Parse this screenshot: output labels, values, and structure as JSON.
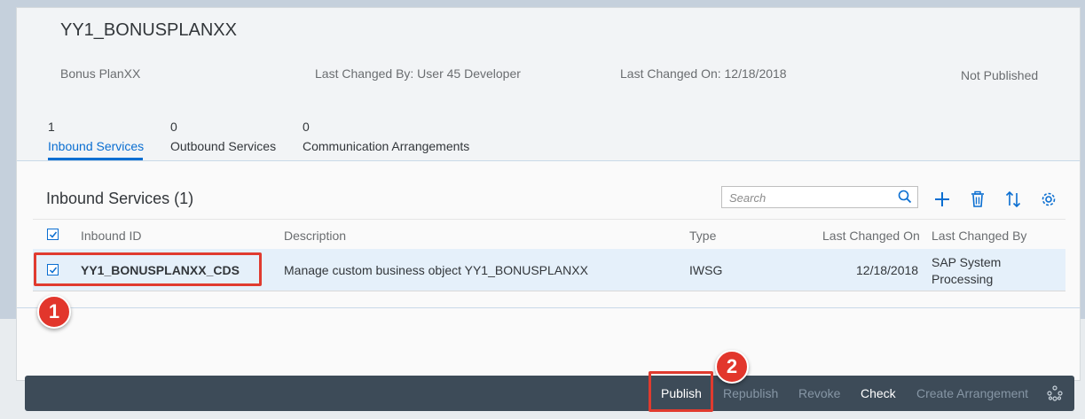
{
  "header": {
    "title": "YY1_BONUSPLANXX",
    "description": "Bonus PlanXX",
    "last_changed_by": "Last Changed By: User 45 Developer",
    "last_changed_on": "Last Changed On: 12/18/2018",
    "status": "Not Published"
  },
  "tabs": [
    {
      "count": "1",
      "label": "Inbound Services",
      "active": true
    },
    {
      "count": "0",
      "label": "Outbound Services",
      "active": false
    },
    {
      "count": "0",
      "label": "Communication Arrangements",
      "active": false
    }
  ],
  "section": {
    "title": "Inbound Services (1)",
    "search_placeholder": "Search",
    "tools": [
      "add-icon",
      "delete-icon",
      "sort-icon",
      "settings-icon"
    ]
  },
  "table": {
    "columns": [
      "Inbound ID",
      "Description",
      "Type",
      "Last Changed On",
      "Last Changed By"
    ],
    "rows": [
      {
        "selected": true,
        "inbound_id": "YY1_BONUSPLANXX_CDS",
        "description": "Manage custom business object YY1_BONUSPLANXX",
        "type": "IWSG",
        "last_changed_on": "12/18/2018",
        "last_changed_by_1": "SAP System",
        "last_changed_by_2": "Processing"
      }
    ]
  },
  "annotations": {
    "step1": "1",
    "step2": "2"
  },
  "footer": {
    "publish": "Publish",
    "republish": "Republish",
    "revoke": "Revoke",
    "check": "Check",
    "create_arrangement": "Create Arrangement",
    "overflow_icon": "overflow-menu-icon"
  },
  "colors": {
    "accent": "#0a6ed1",
    "highlight": "#e03b2f",
    "footer_bg": "#3d4b58"
  }
}
